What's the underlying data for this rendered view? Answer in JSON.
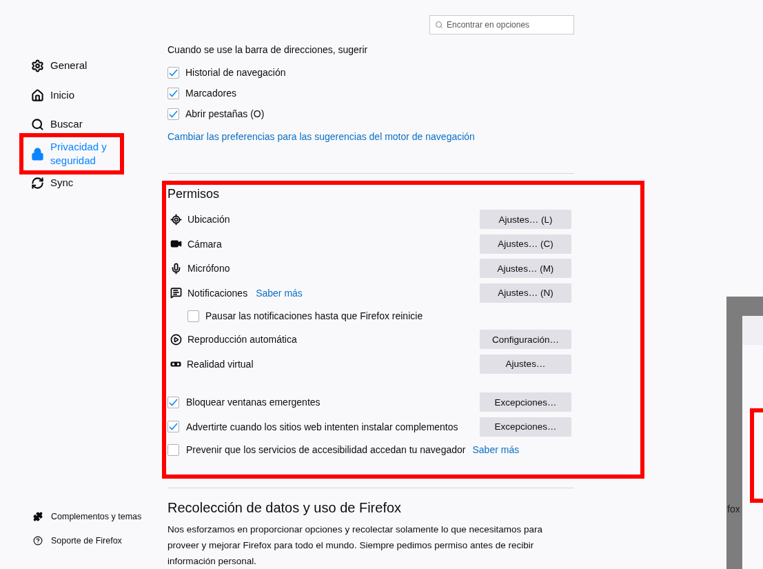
{
  "search": {
    "placeholder": "Encontrar en opciones"
  },
  "sidebar": {
    "items": [
      {
        "label": "General",
        "selected": false,
        "highlighted": false
      },
      {
        "label": "Inicio",
        "selected": false,
        "highlighted": false
      },
      {
        "label": "Buscar",
        "selected": false,
        "highlighted": false
      },
      {
        "label": "Privacidad y seguridad",
        "selected": true,
        "highlighted": true
      },
      {
        "label": "Sync",
        "selected": false,
        "highlighted": false
      }
    ],
    "footer": [
      {
        "label": "Complementos y temas"
      },
      {
        "label": "Soporte de Firefox"
      }
    ]
  },
  "address_bar": {
    "heading": "Cuando se use la barra de direcciones, sugerir",
    "options": [
      {
        "label": "Historial de navegación",
        "checked": true
      },
      {
        "label": "Marcadores",
        "checked": true
      },
      {
        "label": "Abrir pestañas (O)",
        "checked": true
      }
    ],
    "link": "Cambiar las preferencias para las sugerencias del motor de navegación"
  },
  "permissions": {
    "title": "Permisos",
    "highlighted": true,
    "settings": [
      {
        "label": "Ubicación",
        "button": "Ajustes… (L)"
      },
      {
        "label": "Cámara",
        "button": "Ajustes… (C)"
      },
      {
        "label": "Micrófono",
        "button": "Ajustes… (M)"
      },
      {
        "label": "Notificaciones",
        "link": "Saber más",
        "button": "Ajustes… (N)",
        "children": [
          {
            "label": "Pausar las notificaciones hasta que Firefox reinicie",
            "checked": false
          }
        ]
      },
      {
        "label": "Reproducción automática",
        "button": "Configuración…"
      },
      {
        "label": "Realidad virtual",
        "button": "Ajustes…"
      }
    ],
    "checks": [
      {
        "label": "Bloquear ventanas emergentes",
        "checked": true,
        "button": "Excepciones…"
      },
      {
        "label": "Advertirte cuando los sitios web intenten instalar complementos",
        "checked": true,
        "button": "Excepciones…"
      },
      {
        "label": "Prevenir que los servicios de accesibilidad accedan tu navegador",
        "checked": false,
        "link": "Saber más"
      }
    ]
  },
  "data_collection": {
    "title": "Recolección de datos y uso de Firefox",
    "text": "Nos esforzamos en proporcionar opciones y recolectar solamente lo que necesitamos para proveer y mejorar Firefox para todo el mundo. Siempre pedimos permiso antes de recibir información personal."
  },
  "overlay_window": {
    "text": "fox",
    "highlighted": true
  }
}
